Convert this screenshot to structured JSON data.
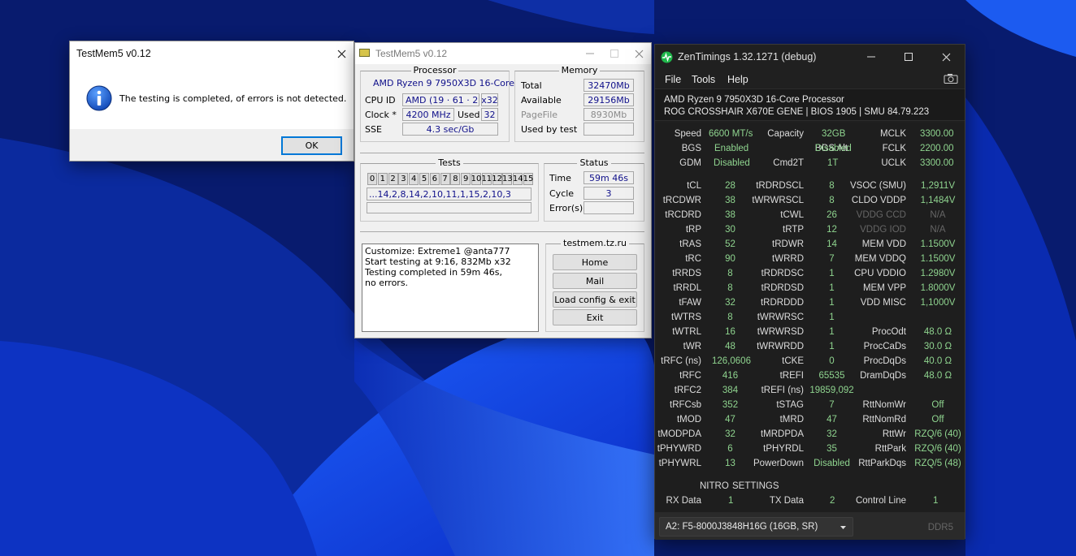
{
  "msgbox": {
    "title": "TestMem5 v0.12",
    "message": "The testing is completed, of errors is not detected.",
    "ok_label": "OK"
  },
  "testmem": {
    "title": "TestMem5 v0.12",
    "processor": {
      "group_title": "Processor",
      "name": "AMD Ryzen 9 7950X3D 16-Core",
      "cpu_id_label": "CPU ID",
      "cpu_vendor": "AMD",
      "cpu_id": "(19 · 61 · 2)",
      "bitness": "x32",
      "clock_label": "Clock *",
      "clock": "4200 MHz",
      "used_label": "Used",
      "used": "32",
      "sse_label": "SSE",
      "sse": "4.3 sec/Gb"
    },
    "memory": {
      "group_title": "Memory",
      "total_label": "Total",
      "total": "32470Mb",
      "available_label": "Available",
      "available": "29156Mb",
      "pagefile_label": "PageFile",
      "pagefile": "8930Mb",
      "used_by_test_label": "Used by test",
      "used_by_test": ""
    },
    "tests": {
      "group_title": "Tests",
      "cells": [
        "0",
        "1",
        "2",
        "3",
        "4",
        "5",
        "6",
        "7",
        "8",
        "9",
        "10",
        "11",
        "12",
        "13",
        "14",
        "15"
      ],
      "sequence": "...14,2,8,14,2,10,11,1,15,2,10,3"
    },
    "status": {
      "group_title": "Status",
      "time_label": "Time",
      "time": "59m 46s",
      "cycle_label": "Cycle",
      "cycle": "3",
      "errors_label": "Error(s)",
      "errors": ""
    },
    "log": [
      "Customize: Extreme1 @anta777",
      "Start testing at 9:16, 832Mb x32",
      "Testing completed in 59m 46s,",
      "no errors."
    ],
    "site_label": "testmem.tz.ru",
    "buttons": {
      "home": "Home",
      "mail": "Mail",
      "load": "Load config & exit",
      "exit": "Exit"
    }
  },
  "zen": {
    "title": "ZenTimings 1.32.1271 (debug)",
    "menu": {
      "file": "File",
      "tools": "Tools",
      "help": "Help"
    },
    "cpu": "AMD Ryzen 9 7950X3D 16-Core Processor",
    "board": "ROG CROSSHAIR X670E GENE | BIOS 1905 | SMU 84.79.223",
    "top": {
      "speed_l": "Speed",
      "speed": "6600 MT/s",
      "capacity_l": "Capacity",
      "capacity": "32GB",
      "mclk_l": "MCLK",
      "mclk": "3300.00",
      "bgs_l": "BGS",
      "bgs": "Enabled",
      "bgsalt_l": "BGS Alt",
      "bgsalt": "Disabled",
      "fclk_l": "FCLK",
      "fclk": "2200.00",
      "gdm_l": "GDM",
      "gdm": "Disabled",
      "cmd2t_l": "Cmd2T",
      "cmd2t": "1T",
      "uclk_l": "UCLK",
      "uclk": "3300.00"
    },
    "col1": [
      [
        "tCL",
        "28"
      ],
      [
        "tRCDWR",
        "38"
      ],
      [
        "tRCDRD",
        "38"
      ],
      [
        "tRP",
        "30"
      ],
      [
        "tRAS",
        "52"
      ],
      [
        "tRC",
        "90"
      ],
      [
        "tRRDS",
        "8"
      ],
      [
        "tRRDL",
        "8"
      ],
      [
        "tFAW",
        "32"
      ],
      [
        "tWTRS",
        "8"
      ],
      [
        "tWTRL",
        "16"
      ],
      [
        "tWR",
        "48"
      ],
      [
        "tRFC (ns)",
        "126,0606"
      ],
      [
        "tRFC",
        "416"
      ],
      [
        "tRFC2",
        "384"
      ],
      [
        "tRFCsb",
        "352"
      ],
      [
        "tMOD",
        "47"
      ],
      [
        "tMODPDA",
        "32"
      ],
      [
        "tPHYWRD",
        "6"
      ],
      [
        "tPHYWRL",
        "13"
      ]
    ],
    "col2": [
      [
        "tRDRDSCL",
        "8"
      ],
      [
        "tWRWRSCL",
        "8"
      ],
      [
        "tCWL",
        "26"
      ],
      [
        "tRTP",
        "12"
      ],
      [
        "tRDWR",
        "14"
      ],
      [
        "tWRRD",
        "7"
      ],
      [
        "tRDRDSC",
        "1"
      ],
      [
        "tRDRDSD",
        "1"
      ],
      [
        "tRDRDDD",
        "1"
      ],
      [
        "tWRWRSC",
        "1"
      ],
      [
        "tWRWRSD",
        "1"
      ],
      [
        "tWRWRDD",
        "1"
      ],
      [
        "tCKE",
        "0"
      ],
      [
        "tREFI",
        "65535"
      ],
      [
        "tREFI (ns)",
        "19859,092"
      ],
      [
        "tSTAG",
        "7"
      ],
      [
        "tMRD",
        "47"
      ],
      [
        "tMRDPDA",
        "32"
      ],
      [
        "tPHYRDL",
        "35"
      ],
      [
        "PowerDown",
        "Disabled"
      ]
    ],
    "col3": [
      [
        "VSOC (SMU)",
        "1,2911V"
      ],
      [
        "CLDO VDDP",
        "1,1484V"
      ],
      [
        "VDDG CCD",
        "N/A"
      ],
      [
        "VDDG IOD",
        "N/A"
      ],
      [
        "MEM VDD",
        "1.1500V"
      ],
      [
        "MEM VDDQ",
        "1.1500V"
      ],
      [
        "CPU VDDIO",
        "1.2980V"
      ],
      [
        "MEM VPP",
        "1.8000V"
      ],
      [
        "VDD MISC",
        "1,1000V"
      ],
      [
        "",
        ""
      ],
      [
        "ProcOdt",
        "48.0 Ω"
      ],
      [
        "ProcCaDs",
        "30.0 Ω"
      ],
      [
        "ProcDqDs",
        "40.0 Ω"
      ],
      [
        "DramDqDs",
        "48.0 Ω"
      ],
      [
        "",
        ""
      ],
      [
        "RttNomWr",
        "Off"
      ],
      [
        "RttNomRd",
        "Off"
      ],
      [
        "RttWr",
        "RZQ/6 (40)"
      ],
      [
        "RttPark",
        "RZQ/6 (40)"
      ],
      [
        "RttParkDqs",
        "RZQ/5 (48)"
      ]
    ],
    "nitro": {
      "heading1": "NITRO",
      "heading2": "SETTINGS",
      "rx_l": "RX Data",
      "rx": "1",
      "tx_l": "TX Data",
      "tx": "2",
      "cl_l": "Control Line",
      "cl": "1"
    },
    "module": "A2: F5-8000J3848H16G (16GB, SR)",
    "ddr": "DDR5",
    "colors": {
      "value": "#8fd48f",
      "bg": "#202020"
    }
  }
}
